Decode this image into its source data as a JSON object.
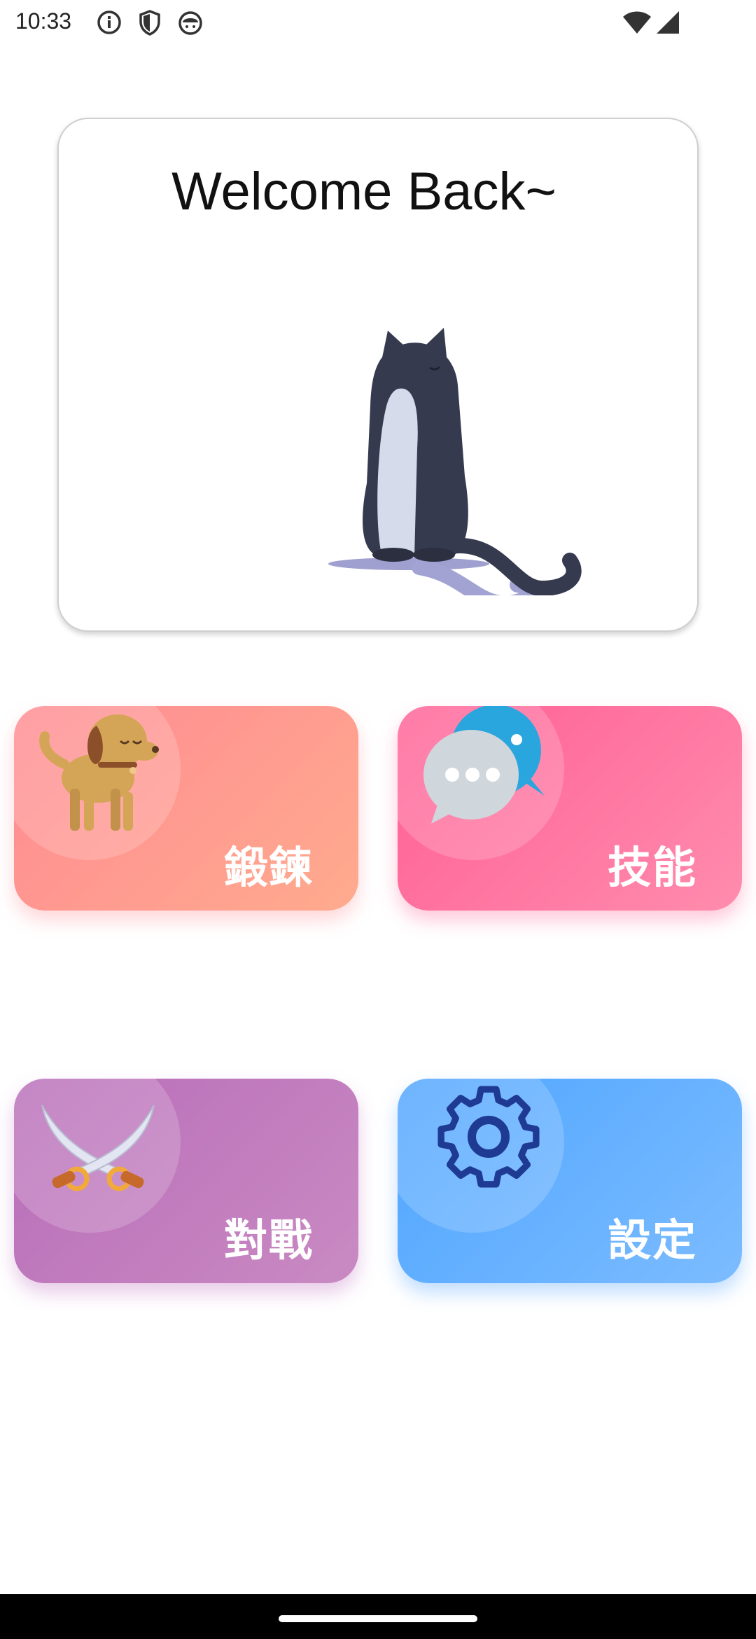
{
  "status_bar": {
    "time": "10:33",
    "left_icons": [
      "info-icon",
      "shield-icon",
      "android-icon"
    ],
    "right_icons": [
      "wifi-icon",
      "signal-icon"
    ]
  },
  "welcome": {
    "title": "Welcome Back~",
    "illustration": "cat-illustration"
  },
  "menu": {
    "tiles": [
      {
        "label": "鍛鍊",
        "icon": "dog-icon",
        "color": "#ff8a92"
      },
      {
        "label": "技能",
        "icon": "chat-bubbles-icon",
        "color": "#ff5f95"
      },
      {
        "label": "對戰",
        "icon": "crossed-swords-icon",
        "color": "#b86db9"
      },
      {
        "label": "設定",
        "icon": "gear-icon",
        "color": "#4fa5ff"
      }
    ]
  },
  "colors": {
    "background": "#ffffff",
    "nav_bar": "#000000"
  }
}
